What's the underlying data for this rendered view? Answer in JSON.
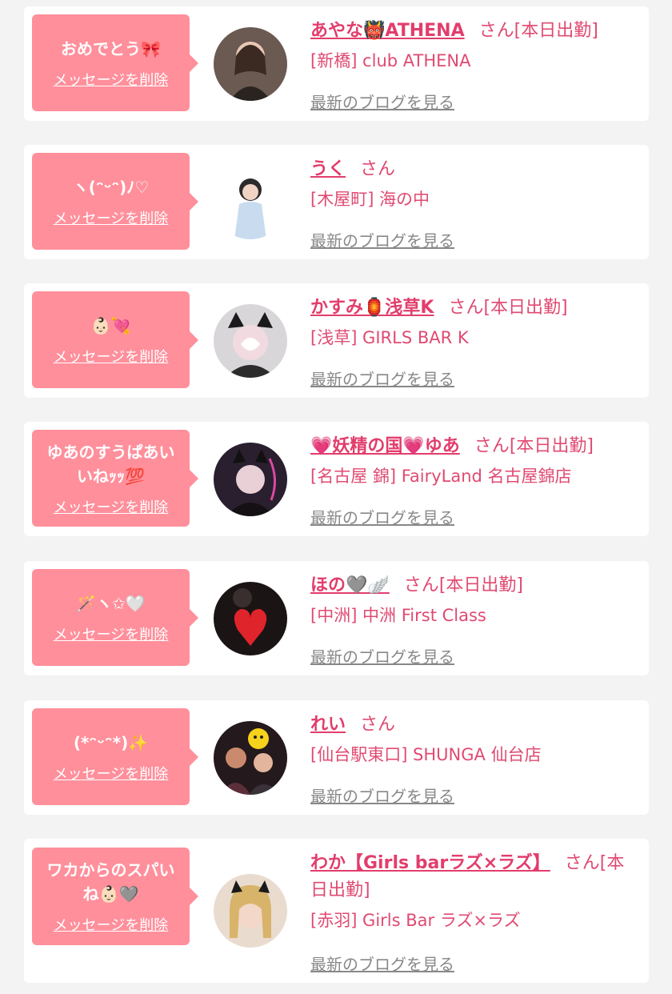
{
  "entries": [
    {
      "message": "おめでとう🎀",
      "delete_label": "メッセージを削除",
      "name": "あやな👹ATHENA",
      "honorific": "さん",
      "status": "[本日出勤]",
      "shop": "[新橋] club ATHENA",
      "blog_label": "最新のブログを見る"
    },
    {
      "message": "ヽ(ᵔᵕᵔ)ﾉ♡",
      "delete_label": "メッセージを削除",
      "name": "うく",
      "honorific": "さん",
      "status": "",
      "shop": "[木屋町] 海の中",
      "blog_label": "最新のブログを見る"
    },
    {
      "message": "👶🏻💘",
      "delete_label": "メッセージを削除",
      "name": "かすみ🏮浅草K",
      "honorific": "さん",
      "status": "[本日出勤]",
      "shop": "[浅草] GIRLS BAR K",
      "blog_label": "最新のブログを見る"
    },
    {
      "message": "ゆあのすうぱあいいねｯｯ💯",
      "delete_label": "メッセージを削除",
      "name": "💗妖精の国💗ゆあ",
      "honorific": "さん",
      "status": "[本日出勤]",
      "shop": "[名古屋 錦] FairyLand 名古屋錦店",
      "blog_label": "最新のブログを見る"
    },
    {
      "message": "🪄ヽ✩🤍",
      "delete_label": "メッセージを削除",
      "name": "ほの🩶🪽",
      "honorific": "さん",
      "status": "[本日出勤]",
      "shop": "[中洲] 中洲 First Class",
      "blog_label": "最新のブログを見る"
    },
    {
      "message": "(*ᵔᵕᵔ*)✨",
      "delete_label": "メッセージを削除",
      "name": "れい",
      "honorific": "さん",
      "status": "",
      "shop": "[仙台駅東口] SHUNGA 仙台店",
      "blog_label": "最新のブログを見る"
    },
    {
      "message": "ワカからのスパいね👶🏻🩶",
      "delete_label": "メッセージを削除",
      "name": "わか【Girls barラズ×ラズ】",
      "honorific": "さん",
      "status": "[本日出勤]",
      "shop": "[赤羽] Girls Bar ラズ×ラズ",
      "blog_label": "最新のブログを見る"
    }
  ],
  "colors": {
    "page_bg": "#f3f3f3",
    "bubble": "#ff8f9b",
    "name": "#e23d6c",
    "text": "#e04a72",
    "link_gray": "#888888"
  }
}
